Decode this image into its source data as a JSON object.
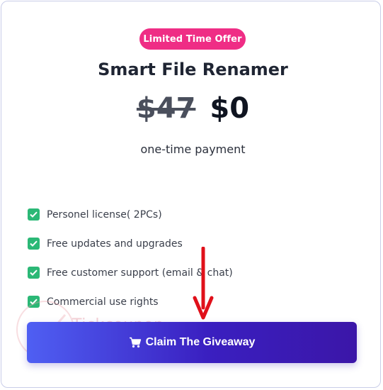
{
  "badge": {
    "label": "Limited Time Offer"
  },
  "product": {
    "title": "Smart File Renamer"
  },
  "pricing": {
    "original_price": "$47",
    "sale_price": "$0",
    "subtitle": "one-time payment"
  },
  "features": [
    {
      "label": "Personel license( 2PCs)"
    },
    {
      "label": "Free updates and upgrades"
    },
    {
      "label": "Free customer support (email & chat)"
    },
    {
      "label": "Commercial use rights"
    }
  ],
  "cta": {
    "label": "Claim The Giveaway",
    "icon": "cart-icon"
  },
  "watermark": {
    "line1": "Tickcoupon",
    "line2": "Giveaway"
  },
  "colors": {
    "badge": "#ef2d85",
    "check": "#2bb876",
    "button_start": "#4f5ff3",
    "button_end": "#3b16a8",
    "arrow": "#e0101a"
  }
}
